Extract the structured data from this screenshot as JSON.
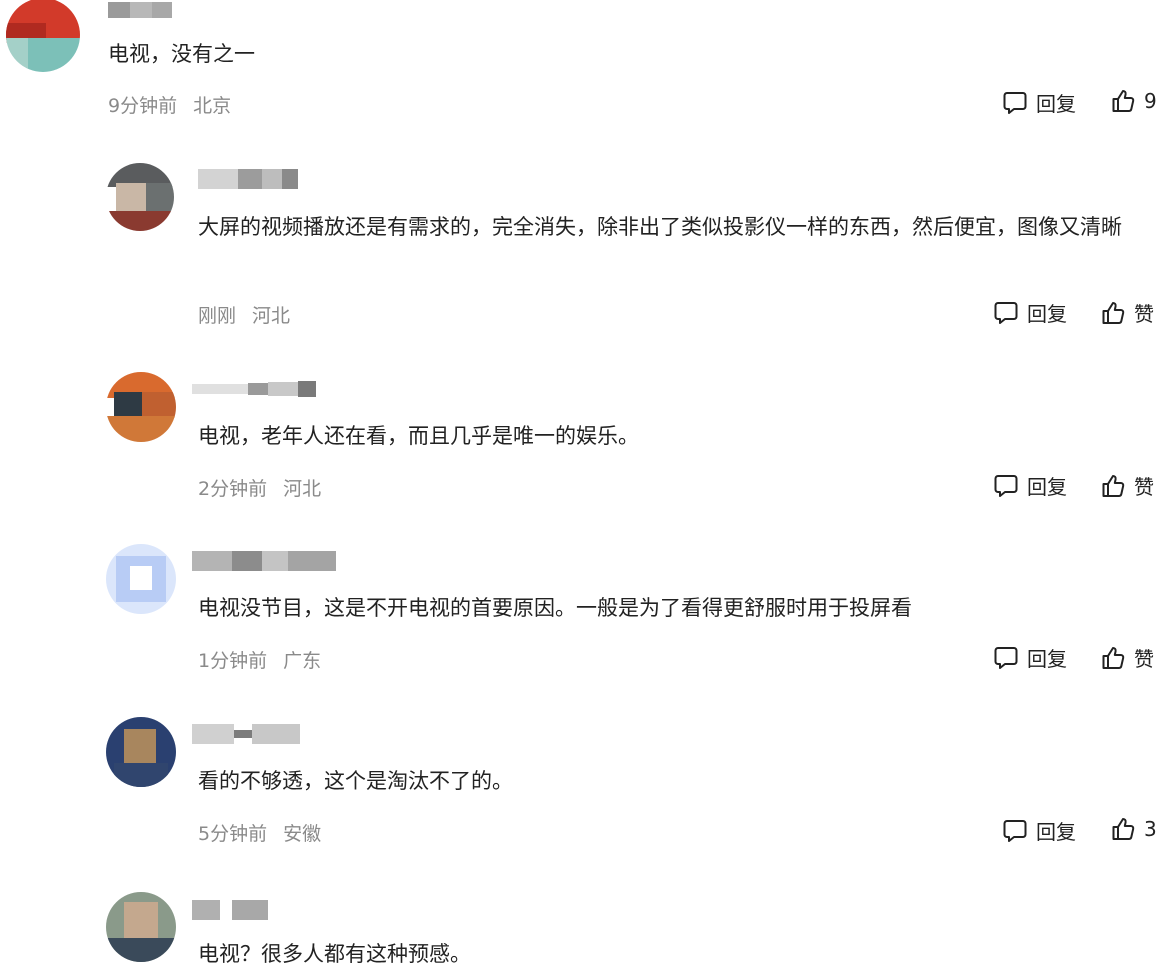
{
  "actions": {
    "reply_label": "回复",
    "like_label": "赞"
  },
  "comments": [
    {
      "text": "电视，没有之一",
      "time": "9分钟前",
      "location": "北京",
      "likes": "9"
    },
    {
      "text": "大屏的视频播放还是有需求的，完全消失，除非出了类似投影仪一样的东西，然后便宜，图像又清晰",
      "time": "刚刚",
      "location": "河北",
      "likes": "赞"
    },
    {
      "text": "电视，老年人还在看，而且几乎是唯一的娱乐。",
      "time": "2分钟前",
      "location": "河北",
      "likes": "赞"
    },
    {
      "text": "电视没节目，这是不开电视的首要原因。一般是为了看得更舒服时用于投屏看",
      "time": "1分钟前",
      "location": "广东",
      "likes": "赞"
    },
    {
      "text": "看的不够透，这个是淘汰不了的。",
      "time": "5分钟前",
      "location": "安徽",
      "likes": "3"
    },
    {
      "text": "电视？很多人都有这种预感。"
    }
  ]
}
